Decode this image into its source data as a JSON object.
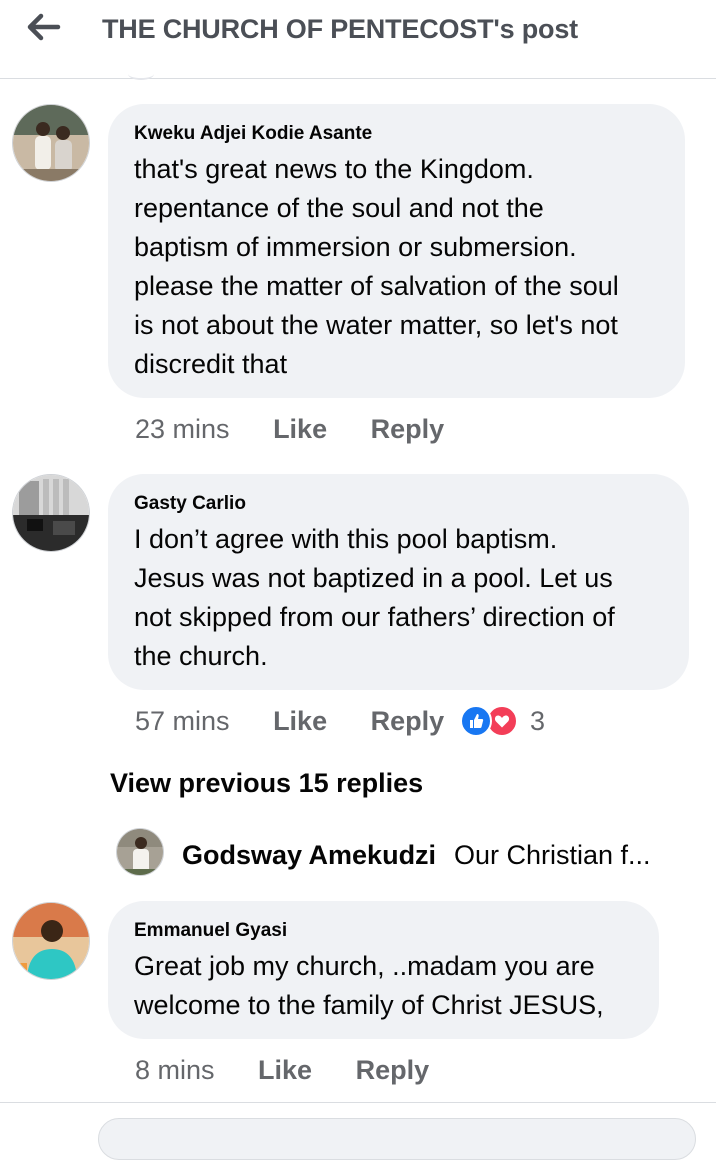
{
  "header": {
    "title": "THE CHURCH OF PENTECOST's post"
  },
  "comments": [
    {
      "author": "Kweku Adjei Kodie Asante",
      "lines": [
        "that's great news to the Kingdom.",
        "repentance of the soul and not the",
        "baptism of immersion or submersion.",
        "please the matter of salvation of the soul",
        "is not about the water matter, so let's not",
        "discredit that"
      ],
      "time": "23 mins",
      "like_label": "Like",
      "reply_label": "Reply"
    },
    {
      "author": "Gasty Carlio",
      "lines": [
        "I don’t agree with this pool baptism.",
        "Jesus was not baptized in a pool. Let us",
        "not skipped from our fathers’ direction of",
        "the church."
      ],
      "time": "57 mins",
      "like_label": "Like",
      "reply_label": "Reply",
      "reaction_count": "3"
    },
    {
      "author": "Emmanuel Gyasi",
      "lines": [
        "Great job my church, ..madam you are",
        "welcome to the family of Christ JESUS,"
      ],
      "time": "8 mins",
      "like_label": "Like",
      "reply_label": "Reply"
    }
  ],
  "view_previous_label": "View previous 15 replies",
  "reply_preview": {
    "author": "Godsway Amekudzi",
    "snippet": "Our Christian f..."
  },
  "colors": {
    "bubble": "#f0f2f5",
    "like_blue": "#1877f2",
    "love_red": "#f33e58",
    "meta_gray": "#65676b"
  },
  "icons": {
    "back": "arrow-left-icon",
    "like_reaction": "thumbs-up-icon",
    "love_reaction": "heart-icon"
  }
}
